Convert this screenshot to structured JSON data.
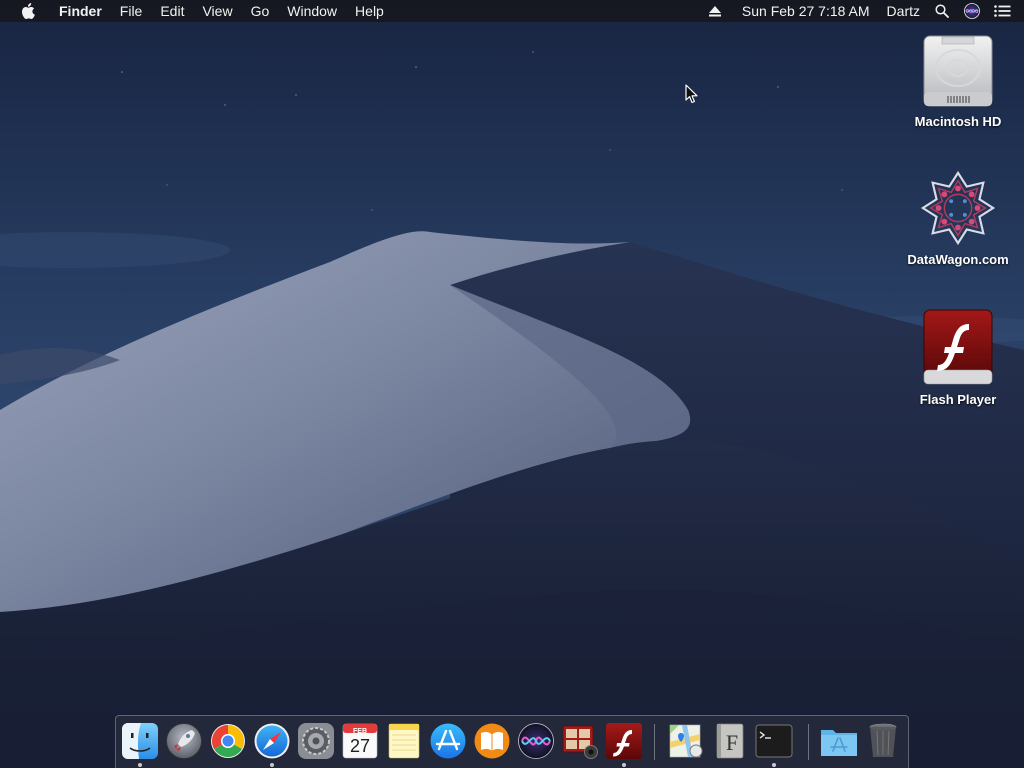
{
  "menubar": {
    "app_name": "Finder",
    "menus": [
      "File",
      "Edit",
      "View",
      "Go",
      "Window",
      "Help"
    ],
    "datetime": "Sun Feb 27  7:18 AM",
    "user": "Dartz",
    "icons": [
      "apple-logo-icon",
      "eject-icon",
      "spotlight-search-icon",
      "siri-icon",
      "notification-center-icon"
    ]
  },
  "desktop": {
    "icons": [
      {
        "label": "Macintosh HD",
        "icon": "hard-drive-icon"
      },
      {
        "label": "DataWagon.com",
        "icon": "datawagon-icon"
      },
      {
        "label": "Flash Player",
        "icon": "flash-player-icon"
      }
    ]
  },
  "dock": {
    "calendar": {
      "month": "FEB",
      "day": "27"
    },
    "apps": [
      {
        "name": "Finder",
        "icon": "finder-icon",
        "running": true
      },
      {
        "name": "Launchpad",
        "icon": "launchpad-icon",
        "running": false
      },
      {
        "name": "Google Chrome",
        "icon": "chrome-icon",
        "running": false
      },
      {
        "name": "Safari",
        "icon": "safari-icon",
        "running": true
      },
      {
        "name": "System Preferences",
        "icon": "system-preferences-icon",
        "running": false
      },
      {
        "name": "Calendar",
        "icon": "calendar-icon",
        "running": false
      },
      {
        "name": "Notes",
        "icon": "notes-icon",
        "running": false
      },
      {
        "name": "App Store",
        "icon": "app-store-icon",
        "running": false
      },
      {
        "name": "Books",
        "icon": "books-icon",
        "running": false
      },
      {
        "name": "Siri",
        "icon": "siri-icon",
        "running": false
      },
      {
        "name": "Photo Booth",
        "icon": "photo-booth-icon",
        "running": false
      },
      {
        "name": "Flash Player",
        "icon": "flash-player-icon",
        "running": true
      },
      {
        "name": "Maps",
        "icon": "maps-icon",
        "running": false
      },
      {
        "name": "Font Book",
        "icon": "font-book-icon",
        "running": false
      },
      {
        "name": "Terminal",
        "icon": "terminal-icon",
        "running": true
      },
      {
        "name": "Applications",
        "icon": "applications-folder-icon",
        "running": false
      },
      {
        "name": "Trash",
        "icon": "trash-icon",
        "running": false
      }
    ]
  },
  "colors": {
    "sky_top": "#1a2643",
    "sky_mid": "#2f4a70",
    "dune_light": "#8e98b0",
    "dune_shadow": "#1f2740",
    "flash_red": "#8b1010",
    "menubar_bg": "#16181e"
  }
}
